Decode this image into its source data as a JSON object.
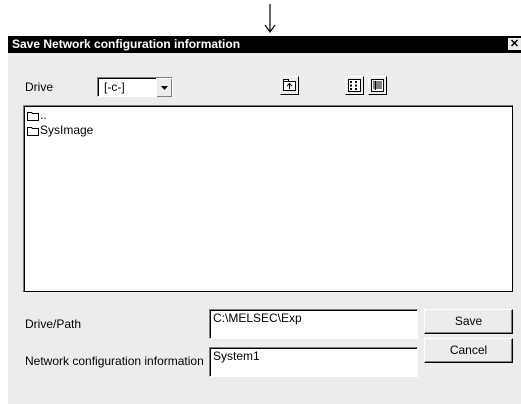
{
  "dialog": {
    "title": "Save Network configuration information",
    "close_glyph": "✕"
  },
  "drive": {
    "label": "Drive",
    "value": "[-c-]"
  },
  "toolbar": {
    "icons": [
      "up-folder-icon",
      "list-view-icon",
      "details-view-icon"
    ]
  },
  "files": [
    {
      "name": "..",
      "icon": "folder-icon"
    },
    {
      "name": "SysImage",
      "icon": "folder-icon"
    }
  ],
  "drive_path": {
    "label": "Drive/Path",
    "value": "C:\\MELSEC\\Exp"
  },
  "network_info": {
    "label": "Network configuration information",
    "value": "System1"
  },
  "buttons": {
    "save": "Save",
    "cancel": "Cancel"
  }
}
